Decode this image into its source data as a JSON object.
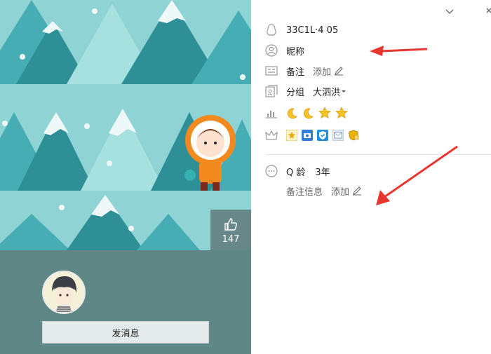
{
  "profile": {
    "qq_number": "33C1L·4 05",
    "nickname": "昵称",
    "remark_label": "备注",
    "add_label": "添加",
    "group_label": "分组",
    "group_value": "大泗洪",
    "age_label": "Q 龄",
    "age_value": "3年",
    "remark_info_label": "备注信息"
  },
  "level_icons": [
    "moon-icon",
    "moon-icon",
    "star-icon",
    "star-icon"
  ],
  "service_icons": [
    "star-badge-icon",
    "camera-badge-icon",
    "shield-badge-icon",
    "mail-badge-icon",
    "vip-badge-icon"
  ],
  "left_panel": {
    "like_count": "147",
    "send_message_label": "发消息"
  },
  "colors": {
    "banner_bg": "#8fd3d5",
    "tree_dark": "#2e8f96",
    "tree_mid": "#45adb3",
    "tree_light": "#a6e0df",
    "bottom_bg": "#5f8785",
    "arrow_red": "#e8352f"
  }
}
